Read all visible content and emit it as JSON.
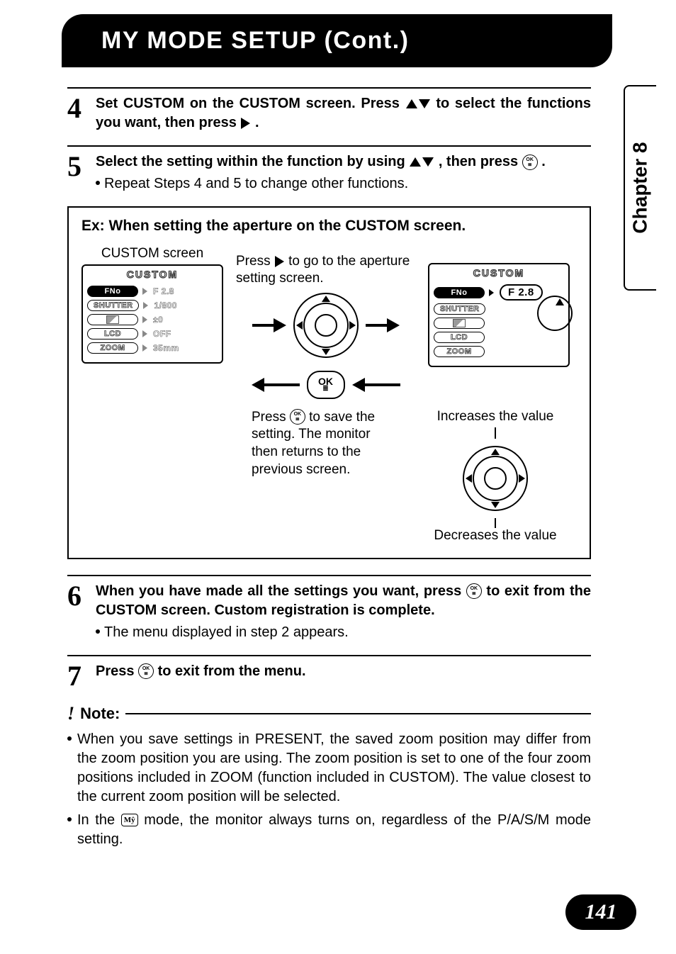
{
  "header": {
    "title": "MY MODE SETUP (Cont.)"
  },
  "sideTab": {
    "label": "Chapter 8"
  },
  "pageNumber": "141",
  "steps": {
    "s4": {
      "num": "4",
      "bold_a": "Set CUSTOM on the CUSTOM screen. Press ",
      "bold_b": " to select the functions you want, then press ",
      "bold_c": "."
    },
    "s5": {
      "num": "5",
      "bold_a": "Select the setting within the function by using ",
      "bold_b": ", then press ",
      "bold_c": ".",
      "sub": "Repeat Steps 4 and 5 to change other functions."
    },
    "s6": {
      "num": "6",
      "bold_a": "When you have made all the settings you want, press ",
      "bold_b": " to exit from the CUSTOM screen. Custom registration is complete.",
      "sub": "The menu displayed in step 2 appears."
    },
    "s7": {
      "num": "7",
      "bold_a": "Press ",
      "bold_b": " to exit from the menu."
    }
  },
  "example": {
    "title": "Ex: When setting the aperture on the CUSTOM screen.",
    "customScreenLabel": "CUSTOM screen",
    "pressRight": "Press ",
    "pressRight2": " to go to the aperture setting screen.",
    "screenTitle": "CUSTOM",
    "left": {
      "rows": [
        {
          "label": "FNo",
          "value": "F 2.8",
          "dark": true
        },
        {
          "label": "SHUTTER",
          "value": "1/800"
        },
        {
          "label": "flag",
          "value": "±0"
        },
        {
          "label": "LCD",
          "value": "OFF"
        },
        {
          "label": "ZOOM",
          "value": "35mm"
        }
      ]
    },
    "right": {
      "rows": [
        {
          "label": "FNo",
          "value": "F 2.8",
          "dark": true,
          "highlight": true
        },
        {
          "label": "SHUTTER"
        },
        {
          "label": "flag"
        },
        {
          "label": "LCD"
        },
        {
          "label": "ZOOM"
        }
      ]
    },
    "okLabel": "OK",
    "saveText_a": "Press ",
    "saveText_b": " to save the setting. The monitor then returns to the previous screen.",
    "increases": "Increases the value",
    "decreases": "Decreases the value"
  },
  "note": {
    "heading": "Note:",
    "items": [
      "When you save settings in PRESENT, the saved zoom position may differ from the zoom position you are using. The zoom position is set to one of the four zoom positions included in ZOOM (function included in CUSTOM). The value closest to the current zoom position will be selected.",
      "In the  mode, the monitor always turns on, regardless of the P/A/S/M mode setting."
    ],
    "item2_a": "In the ",
    "item2_b": " mode, the monitor always turns on, regardless of the P/A/S/M mode setting."
  }
}
